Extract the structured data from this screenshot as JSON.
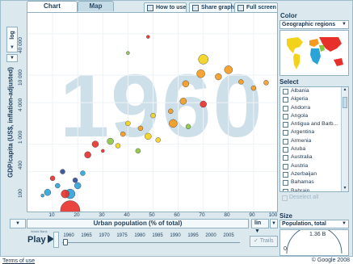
{
  "tabs": [
    {
      "label": "Chart"
    },
    {
      "label": "Map"
    }
  ],
  "toolbar": {
    "how_to_use": "How to use",
    "share_graph": "Share graph",
    "full_screen": "Full screen"
  },
  "y_axis": {
    "scale": "log",
    "label": "GDP/capita (US$, inflation-adjusted)",
    "ticks": [
      "40 000",
      "10 000",
      "4 000",
      "1 000",
      "400",
      "100"
    ]
  },
  "x_axis": {
    "label": "Urban population (% of total)",
    "scale": "lin",
    "ticks": [
      "10",
      "20",
      "30",
      "40",
      "50",
      "60",
      "70",
      "80",
      "90",
      "100"
    ]
  },
  "year": "1960",
  "play": {
    "label": "Play",
    "trails": "Trails",
    "years": [
      "1960",
      "1965",
      "1970",
      "1975",
      "1980",
      "1985",
      "1990",
      "1995",
      "2000",
      "2005"
    ]
  },
  "color_panel": {
    "heading": "Color",
    "selected": "Geographic regions"
  },
  "select_panel": {
    "heading": "Select",
    "countries": [
      "Albania",
      "Algeria",
      "Andorra",
      "Angola",
      "Antigua and Barb...",
      "Argentina",
      "Armenia",
      "Aruba",
      "Australia",
      "Austria",
      "Azerbaijan",
      "Bahamas",
      "Bahrain"
    ],
    "deselect": "Deselect all"
  },
  "size_panel": {
    "heading": "Size",
    "selected": "Population, total",
    "value": "1.36 B",
    "min": "0"
  },
  "footer": {
    "terms": "Terms of use",
    "copyright": "© Google 2008"
  },
  "colors": {
    "asia": "#e8302a",
    "americas": "#f2d21a",
    "europe": "#f59a1d",
    "africa": "#2aa3d8",
    "middle_east": "#8bc53f",
    "oceania": "#2f4a9c"
  },
  "chart_data": {
    "type": "scatter",
    "xlabel": "Urban population (% of total)",
    "ylabel": "GDP/capita (US$, inflation-adjusted)",
    "xlim": [
      0,
      100
    ],
    "y_scale": "log",
    "ylim": [
      100,
      80000
    ],
    "points": [
      {
        "x": 17,
        "y": 110,
        "s": 12,
        "c": "#e8302a"
      },
      {
        "x": 17,
        "y": 190,
        "s": 6,
        "c": "#2aa3d8"
      },
      {
        "x": 15,
        "y": 190,
        "s": 5,
        "c": "#e8302a"
      },
      {
        "x": 20,
        "y": 250,
        "s": 4,
        "c": "#2aa3d8"
      },
      {
        "x": 8,
        "y": 200,
        "s": 4,
        "c": "#2aa3d8"
      },
      {
        "x": 12,
        "y": 250,
        "s": 3,
        "c": "#2aa3d8"
      },
      {
        "x": 6,
        "y": 180,
        "s": 2,
        "c": "#2aa3d8"
      },
      {
        "x": 10,
        "y": 320,
        "s": 3,
        "c": "#e8302a"
      },
      {
        "x": 14,
        "y": 400,
        "s": 3,
        "c": "#2f4a9c"
      },
      {
        "x": 19,
        "y": 300,
        "s": 3,
        "c": "#2f4a9c"
      },
      {
        "x": 22,
        "y": 380,
        "s": 3,
        "c": "#2aa3d8"
      },
      {
        "x": 24,
        "y": 700,
        "s": 4,
        "c": "#e8302a"
      },
      {
        "x": 27,
        "y": 1000,
        "s": 4,
        "c": "#e8302a"
      },
      {
        "x": 30,
        "y": 800,
        "s": 2,
        "c": "#e8302a"
      },
      {
        "x": 33,
        "y": 1100,
        "s": 4,
        "c": "#8bc53f"
      },
      {
        "x": 36,
        "y": 950,
        "s": 3,
        "c": "#f2d21a"
      },
      {
        "x": 38,
        "y": 1400,
        "s": 3,
        "c": "#f59a1d"
      },
      {
        "x": 40,
        "y": 2000,
        "s": 3,
        "c": "#f2d21a"
      },
      {
        "x": 45,
        "y": 1700,
        "s": 3,
        "c": "#f59a1d"
      },
      {
        "x": 48,
        "y": 1300,
        "s": 4,
        "c": "#f2d21a"
      },
      {
        "x": 50,
        "y": 2600,
        "s": 3,
        "c": "#f2d21a"
      },
      {
        "x": 52,
        "y": 1150,
        "s": 3,
        "c": "#f2d21a"
      },
      {
        "x": 57,
        "y": 3000,
        "s": 3,
        "c": "#f59a1d"
      },
      {
        "x": 62,
        "y": 4200,
        "s": 4,
        "c": "#f59a1d"
      },
      {
        "x": 63,
        "y": 7500,
        "s": 4,
        "c": "#f59a1d"
      },
      {
        "x": 69,
        "y": 10500,
        "s": 5,
        "c": "#f59a1d"
      },
      {
        "x": 70,
        "y": 17000,
        "s": 6,
        "c": "#f2d21a"
      },
      {
        "x": 76,
        "y": 9500,
        "s": 4,
        "c": "#f59a1d"
      },
      {
        "x": 80,
        "y": 12000,
        "s": 5,
        "c": "#f59a1d"
      },
      {
        "x": 85,
        "y": 8000,
        "s": 3,
        "c": "#f59a1d"
      },
      {
        "x": 90,
        "y": 6500,
        "s": 3,
        "c": "#f59a1d"
      },
      {
        "x": 95,
        "y": 7800,
        "s": 3,
        "c": "#f59a1d"
      },
      {
        "x": 40,
        "y": 21000,
        "s": 2,
        "c": "#8bc53f"
      },
      {
        "x": 48,
        "y": 36000,
        "s": 2,
        "c": "#e8302a"
      },
      {
        "x": 70,
        "y": 3800,
        "s": 4,
        "c": "#e8302a"
      },
      {
        "x": 58,
        "y": 2000,
        "s": 5,
        "c": "#f59a1d"
      },
      {
        "x": 64,
        "y": 1800,
        "s": 3,
        "c": "#8bc53f"
      },
      {
        "x": 44,
        "y": 800,
        "s": 3,
        "c": "#8bc53f"
      }
    ]
  }
}
